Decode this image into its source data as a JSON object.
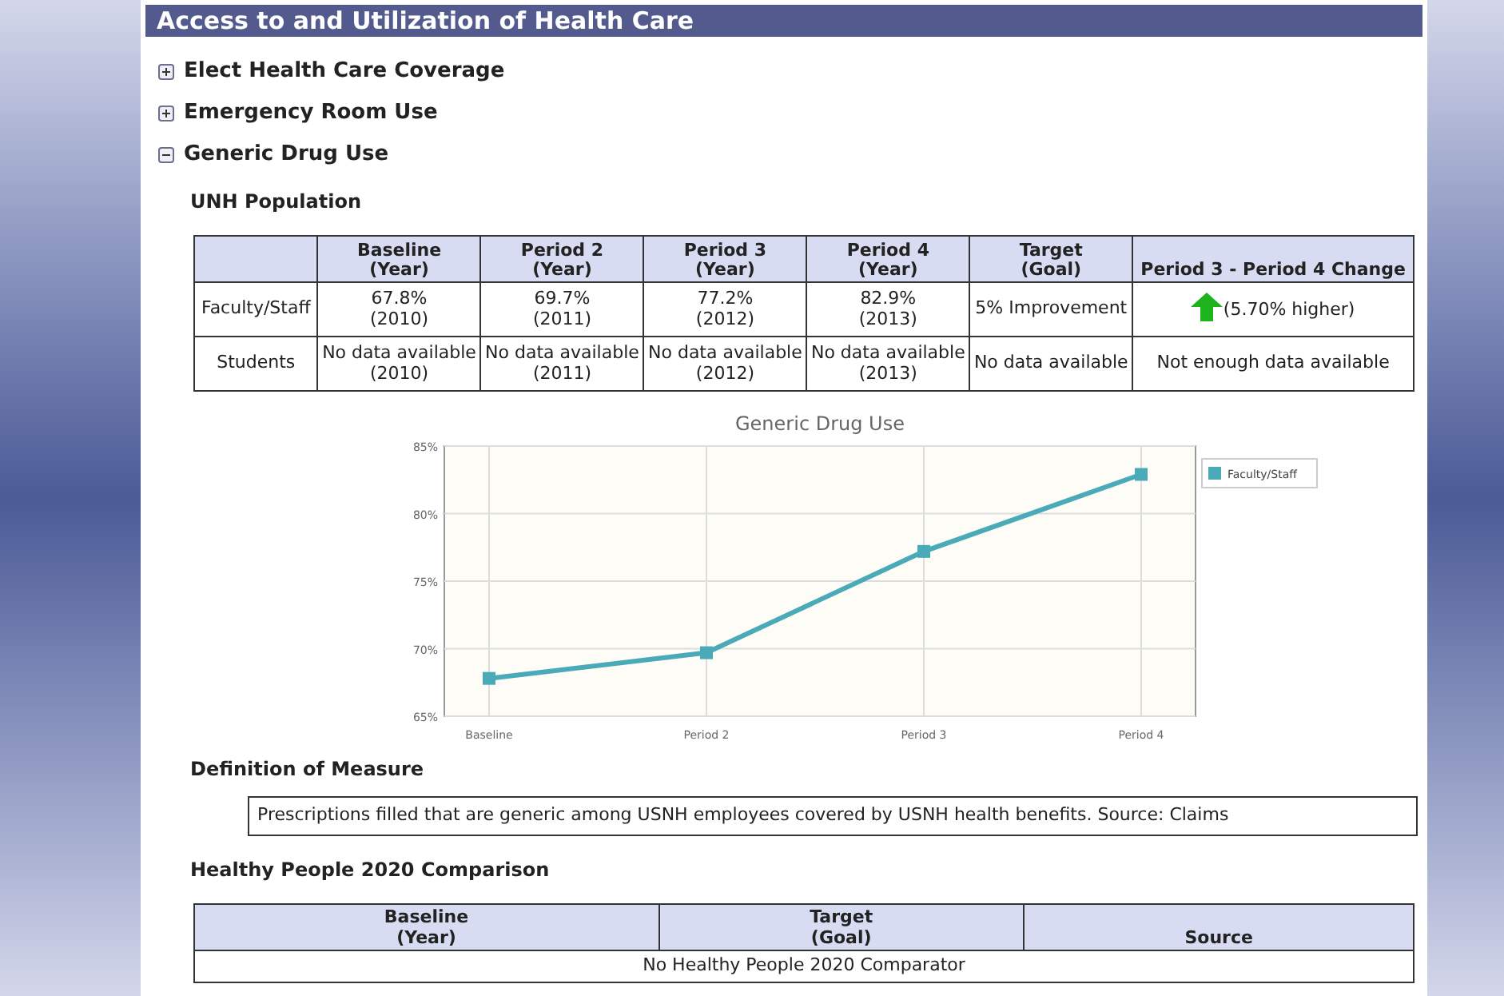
{
  "section_title": "Access to and Utilization of Health Care",
  "items": [
    {
      "label": "Elect Health Care Coverage",
      "expanded": false
    },
    {
      "label": "Emergency Room Use",
      "expanded": false
    },
    {
      "label": "Generic Drug Use",
      "expanded": true
    }
  ],
  "population_heading": "UNH Population",
  "table": {
    "columns": [
      {
        "label": "Baseline",
        "sub": "(Year)"
      },
      {
        "label": "Period 2",
        "sub": "(Year)"
      },
      {
        "label": "Period 3",
        "sub": "(Year)"
      },
      {
        "label": "Period 4",
        "sub": "(Year)"
      },
      {
        "label": "Target",
        "sub": "(Goal)"
      },
      {
        "label": "Period 3 - Period 4 Change"
      }
    ],
    "rows": [
      {
        "label": "Faculty/Staff",
        "cells": [
          {
            "value": "67.8%",
            "sub": "(2010)"
          },
          {
            "value": "69.7%",
            "sub": "(2011)"
          },
          {
            "value": "77.2%",
            "sub": "(2012)"
          },
          {
            "value": "82.9%",
            "sub": "(2013)"
          },
          {
            "value": "5% Improvement"
          },
          {
            "value": "(5.70% higher)",
            "kind": "change_up"
          }
        ]
      },
      {
        "label": "Students",
        "cells": [
          {
            "value": "No data available",
            "sub": "(2010)"
          },
          {
            "value": "No data available",
            "sub": "(2011)"
          },
          {
            "value": "No data available",
            "sub": "(2012)"
          },
          {
            "value": "No data available",
            "sub": "(2013)"
          },
          {
            "value": "No data available"
          },
          {
            "value": "Not enough data available"
          }
        ]
      }
    ]
  },
  "chart_data": {
    "type": "line",
    "title": "Generic Drug Use",
    "categories": [
      "Baseline",
      "Period 2",
      "Period 3",
      "Period 4"
    ],
    "series": [
      {
        "name": "Faculty/Staff",
        "color": "#4aaab8",
        "marker": "square",
        "values": [
          67.8,
          69.7,
          77.2,
          82.9
        ]
      }
    ],
    "grid": true,
    "ylim": [
      65,
      85
    ],
    "yticks": [
      {
        "value": 65,
        "label": "65%"
      },
      {
        "value": 70,
        "label": "70%"
      },
      {
        "value": 75,
        "label": "75%"
      },
      {
        "value": 80,
        "label": "80%"
      },
      {
        "value": 85,
        "label": "85%"
      }
    ]
  },
  "definition_heading": "Definition of Measure",
  "definition": "Prescriptions filled that are generic among USNH employees covered by USNH health benefits. Source: Claims",
  "comparison_heading": "Healthy People 2020 Comparison",
  "comparison_table": {
    "columns": [
      {
        "label": "Baseline",
        "sub": "(Year)"
      },
      {
        "label": "Target",
        "sub": "(Goal)"
      },
      {
        "label": "Source"
      }
    ],
    "message": "No Healthy People 2020 Comparator"
  }
}
